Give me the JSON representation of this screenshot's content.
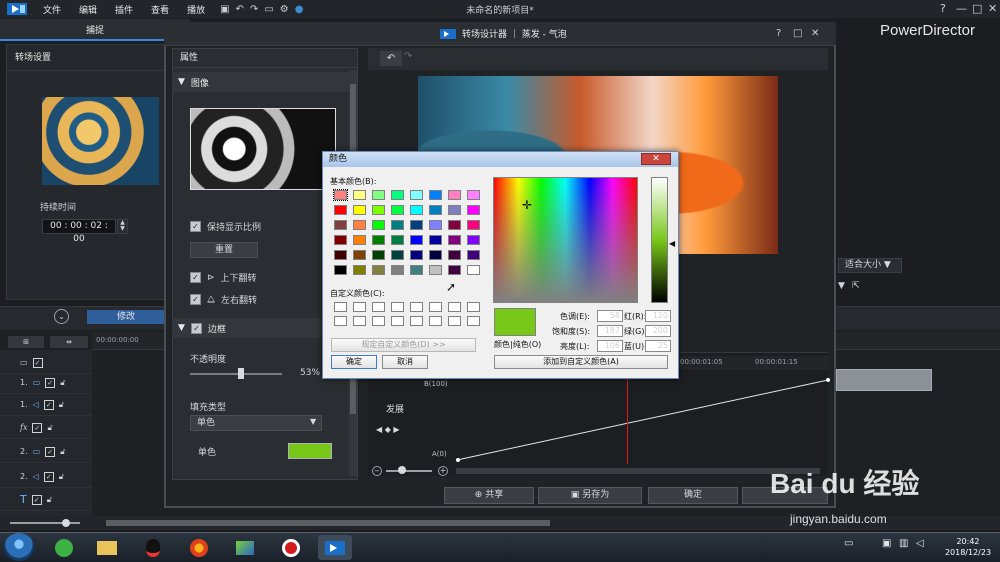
{
  "app": {
    "window_title": "未命名的新项目*",
    "brand": "PowerDirector",
    "menu": [
      "文件",
      "编辑",
      "插件",
      "查看",
      "播放"
    ],
    "capture_tab": "捕捉",
    "win_controls": [
      "?",
      "—",
      "□",
      "✕"
    ]
  },
  "left_panel": {
    "title": "转场设置",
    "duration_label": "持续时间",
    "duration_value": "00 : 00 : 02 : 00"
  },
  "timeline": {
    "edit_button": "修改",
    "ruler_start": "00:00:00:00",
    "tracks": [
      {
        "num": "",
        "icon": "display"
      },
      {
        "num": "1.",
        "icon": "video"
      },
      {
        "num": "1.",
        "icon": "audio"
      },
      {
        "num": "",
        "icon": "fx",
        "label": "fx"
      },
      {
        "num": "2.",
        "icon": "video"
      },
      {
        "num": "2.",
        "icon": "audio"
      },
      {
        "num": "",
        "icon": "title",
        "label": "T"
      },
      {
        "num": "",
        "icon": "voice"
      }
    ]
  },
  "designer": {
    "title": "转场设计器 ｜ 蒸发 - 气泡",
    "controls": [
      "?",
      "□",
      "✕"
    ],
    "properties_title": "属性",
    "image_section": "图像",
    "keep_ratio": "保持显示比例",
    "reset": "重置",
    "flip_vertical": "上下翻转",
    "flip_horizontal": "左右翻转",
    "border_section": "边框",
    "opacity_label": "不透明度",
    "opacity_value": "53%",
    "opacity_level": 0.53,
    "fill_type_label": "填充类型",
    "fill_type_value": "单色",
    "solid_label": "单色",
    "solid_color": "#78c81a",
    "fit_label": "适合大小",
    "graph": {
      "b_label": "B(100)",
      "a_label": "A(0)",
      "axis_label": "发展",
      "ticks": [
        "00:00:01:05",
        "00:00:01:15"
      ],
      "kf_nav": "◀ ◆ ▶"
    },
    "buttons": {
      "share": "共享",
      "save_as": "另存为",
      "ok": "确定"
    }
  },
  "color_dialog": {
    "title": "颜色",
    "close": "✕",
    "basic_colors_label": "基本颜色(B):",
    "custom_colors_label": "自定义颜色(C):",
    "define_custom": "规定自定义颜色(D) >>",
    "ok": "确定",
    "cancel": "取消",
    "color_solid_label": "颜色|纯色(O)",
    "add_custom": "添加到自定义颜色(A)",
    "hue_label": "色调(E):",
    "hue": "58",
    "sat_label": "饱和度(S):",
    "sat": "187",
    "lum_label": "亮度(L):",
    "lum": "106",
    "red_label": "红(R):",
    "red": "120",
    "green_label": "绿(G):",
    "green": "200",
    "blue_label": "蓝(U):",
    "blue": "25",
    "selected_color": "#78c81a",
    "basic_colors": [
      [
        "#ff8080",
        "#ffff80",
        "#80ff80",
        "#00ff80",
        "#80ffff",
        "#0080ff",
        "#ff80c0",
        "#ff80ff"
      ],
      [
        "#ff0000",
        "#ffff00",
        "#80ff00",
        "#00ff40",
        "#00ffff",
        "#0080c0",
        "#8080c0",
        "#ff00ff"
      ],
      [
        "#804040",
        "#ff8040",
        "#00ff00",
        "#008080",
        "#004080",
        "#8080ff",
        "#800040",
        "#ff0080"
      ],
      [
        "#800000",
        "#ff8000",
        "#008000",
        "#008040",
        "#0000ff",
        "#0000a0",
        "#800080",
        "#8000ff"
      ],
      [
        "#400000",
        "#804000",
        "#004000",
        "#004040",
        "#000080",
        "#000040",
        "#400040",
        "#400080"
      ],
      [
        "#000000",
        "#808000",
        "#808040",
        "#808080",
        "#408080",
        "#c0c0c0",
        "#400040",
        "#ffffff"
      ]
    ]
  },
  "taskbar": {
    "time": "20:42",
    "date": "2018/12/23"
  },
  "watermark": {
    "text": "Bai du 经验",
    "url": "jingyan.baidu.com"
  }
}
